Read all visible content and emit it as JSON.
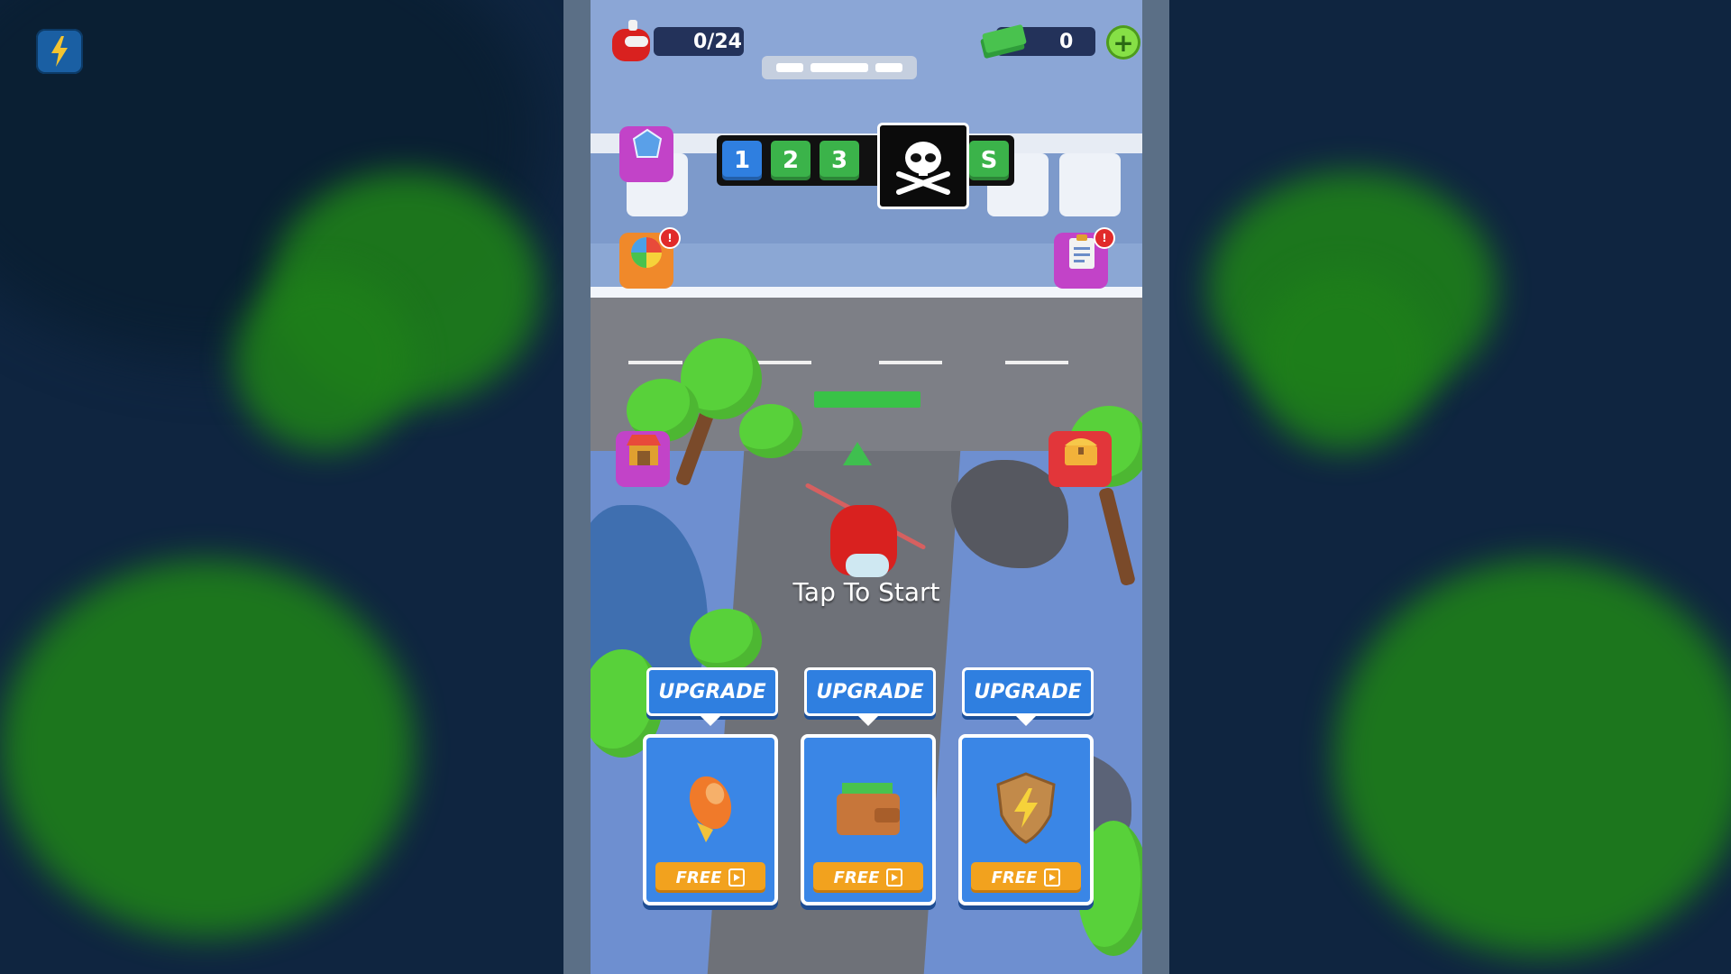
{
  "hud": {
    "kills": "0/24",
    "cash": "0",
    "plus_label": "+"
  },
  "levels": {
    "stages": [
      "1",
      "2",
      "3"
    ],
    "final_stage": "S"
  },
  "side_buttons": {
    "top_left_label": "",
    "spin_label": "",
    "task_label": "",
    "shop_label": "",
    "chest_label": ""
  },
  "prompt": "Tap To Start",
  "upgrades": [
    {
      "button": "UPGRADE",
      "level": "",
      "action": "FREE",
      "icon": "rocket-icon"
    },
    {
      "button": "UPGRADE",
      "level": "",
      "action": "FREE",
      "icon": "wallet-icon"
    },
    {
      "button": "UPGRADE",
      "level": "",
      "action": "FREE",
      "icon": "shield-icon"
    }
  ],
  "colors": {
    "stage_blue": "#2f7fe0",
    "stage_green": "#3bb34a",
    "upgrade_blue": "#2f7fe0",
    "free_orange": "#f2a21e",
    "player_red": "#d9211f"
  }
}
